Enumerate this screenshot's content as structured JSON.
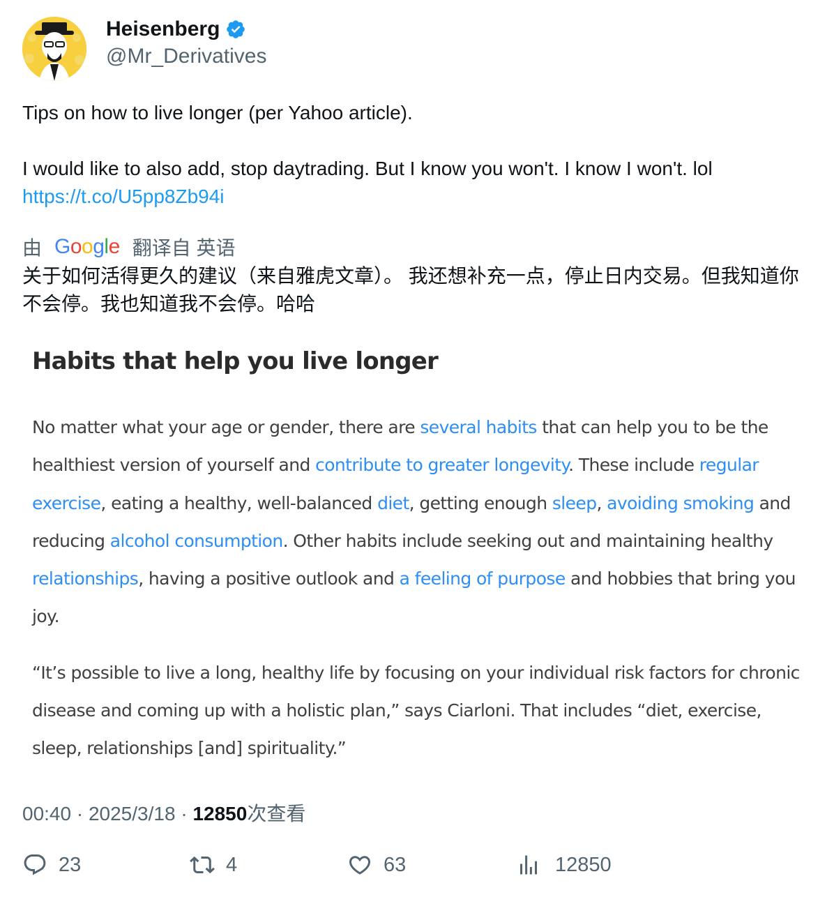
{
  "author": {
    "display_name": "Heisenberg",
    "handle": "@Mr_Derivatives",
    "verified": true
  },
  "tweet": {
    "line1": "Tips on how to live longer (per Yahoo article).",
    "line2": "I would like to also add, stop daytrading. But I know you won't. I know I won't. lol",
    "link": "https://t.co/U5pp8Zb94i"
  },
  "translation": {
    "prefix": "由",
    "provider": "Google",
    "suffix": "翻译自 英语",
    "text": "关于如何活得更久的建议（来自雅虎文章）。 我还想补充一点，停止日内交易。但我知道你不会停。我也知道我不会停。哈哈"
  },
  "article": {
    "title": "Habits that help you live longer",
    "p1": [
      {
        "t": "No matter what your age or gender, there are ",
        "link": false
      },
      {
        "t": "several habits",
        "link": true
      },
      {
        "t": " that can help you to be the healthiest version of yourself and ",
        "link": false
      },
      {
        "t": "contribute to greater longevity",
        "link": true
      },
      {
        "t": ". These include ",
        "link": false
      },
      {
        "t": "regular exercise",
        "link": true
      },
      {
        "t": ", eating a healthy, well-balanced ",
        "link": false
      },
      {
        "t": "diet",
        "link": true
      },
      {
        "t": ", getting enough ",
        "link": false
      },
      {
        "t": "sleep",
        "link": true
      },
      {
        "t": ", ",
        "link": false
      },
      {
        "t": "avoiding smoking",
        "link": true
      },
      {
        "t": " and reducing ",
        "link": false
      },
      {
        "t": "alcohol consumption",
        "link": true
      },
      {
        "t": ". Other habits include seeking out and maintaining healthy ",
        "link": false
      },
      {
        "t": "relationships",
        "link": true
      },
      {
        "t": ", having a positive outlook and ",
        "link": false
      },
      {
        "t": "a feeling of purpose",
        "link": true
      },
      {
        "t": " and hobbies that bring you joy.",
        "link": false
      }
    ],
    "p2": "“It’s possible to live a long, healthy life by focusing on your individual risk factors for chronic disease and coming up with a holistic plan,” says Ciarloni. That includes “diet, exercise, sleep, relationships [and] spirituality.”"
  },
  "meta": {
    "time": "00:40",
    "date": "2025/3/18",
    "separator": "·",
    "views": "12850",
    "views_label": "次查看"
  },
  "actions": {
    "replies": "23",
    "retweets": "4",
    "likes": "63",
    "views": "12850"
  },
  "colors": {
    "link": "#1d9bf0",
    "article_link": "#2d8ef4",
    "secondary_text": "#536471",
    "verified_badge": "#1d9bf0",
    "avatar_bg": "#f7cf3f"
  }
}
